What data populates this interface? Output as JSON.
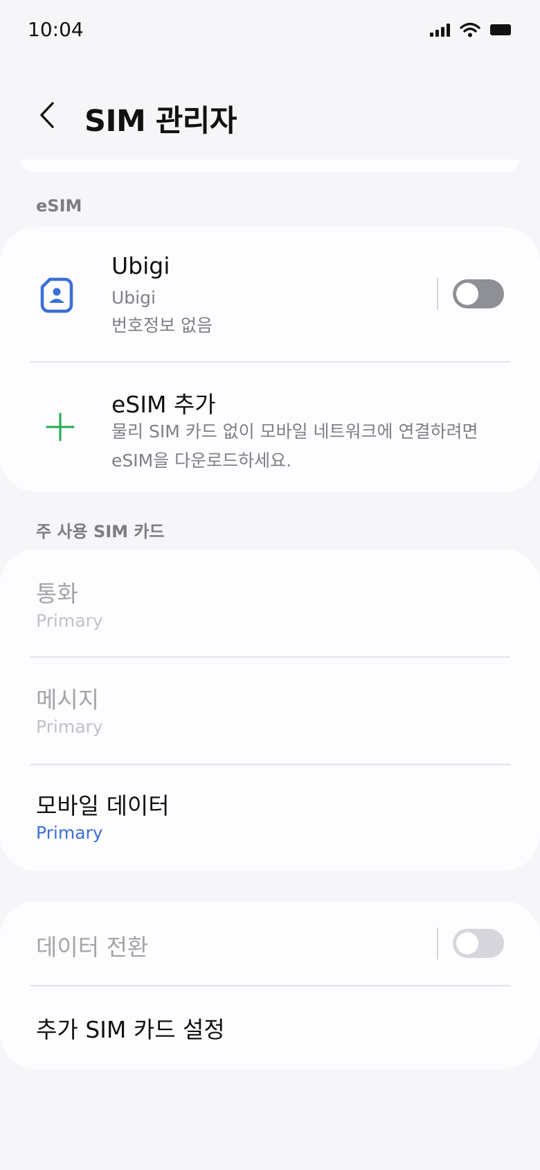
{
  "status_bar": {
    "time": "10:04"
  },
  "header": {
    "title": "SIM 관리자"
  },
  "esim_section": {
    "label": "eSIM",
    "sim": {
      "name": "Ubigi",
      "carrier": "Ubigi",
      "number": "번호정보 없음",
      "enabled": false
    },
    "add": {
      "title": "eSIM 추가",
      "desc_line1": "물리 SIM 카드 없이 모바일 네트워크에 연결하려면",
      "desc_line2": "eSIM을 다운로드하세요."
    }
  },
  "primary_section": {
    "label": "주 사용 SIM 카드",
    "items": [
      {
        "title": "통화",
        "value": "Primary"
      },
      {
        "title": "메시지",
        "value": "Primary"
      },
      {
        "title": "모바일 데이터",
        "value": "Primary"
      }
    ]
  },
  "other_section": {
    "data_switch": {
      "title": "데이터 전환",
      "enabled": false
    },
    "more_settings": {
      "title": "추가 SIM 카드 설정"
    }
  },
  "colors": {
    "accent": "#3a6fd8",
    "sim_icon": "#3a6fd8",
    "add_icon": "#1fa84f",
    "background": "#f6f6f8",
    "card": "#fdfdff"
  }
}
